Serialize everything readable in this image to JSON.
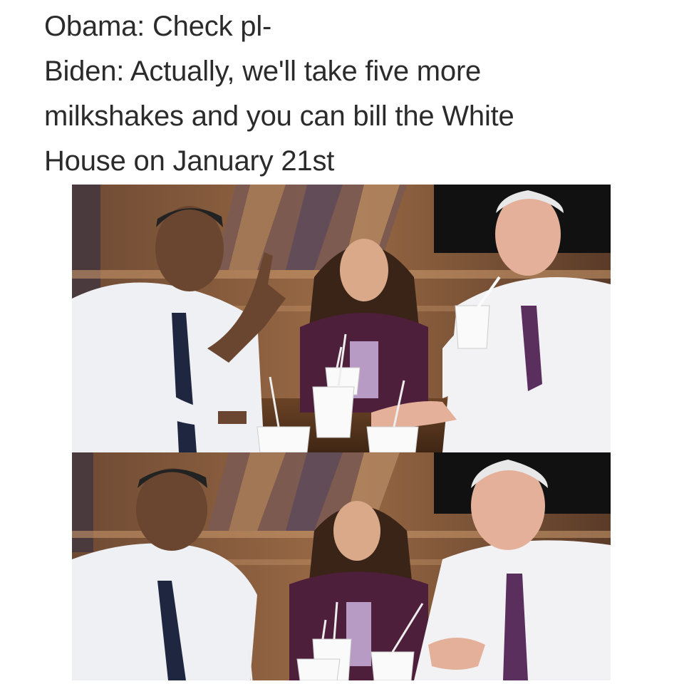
{
  "meme": {
    "caption_lines": [
      "Obama: Check pl-",
      "Biden: Actually, we'll take five more",
      "milkshakes and you can bill the White",
      "House on January 21st"
    ]
  },
  "photos": {
    "top_panel": "three people at a cafe table with milkshakes; man on right sips through straw while man on left raises hand",
    "bottom_panel": "same three people; man on right talks and gestures, man on left looks at him"
  },
  "colors": {
    "caption_text": "#2b2b2b",
    "wood_wall": "#8a5a3a",
    "shirt_white": "#f2f2f4",
    "tie_navy": "#1f2640",
    "tie_purple": "#5a2f5e",
    "jacket_plum": "#4e1f3a"
  }
}
